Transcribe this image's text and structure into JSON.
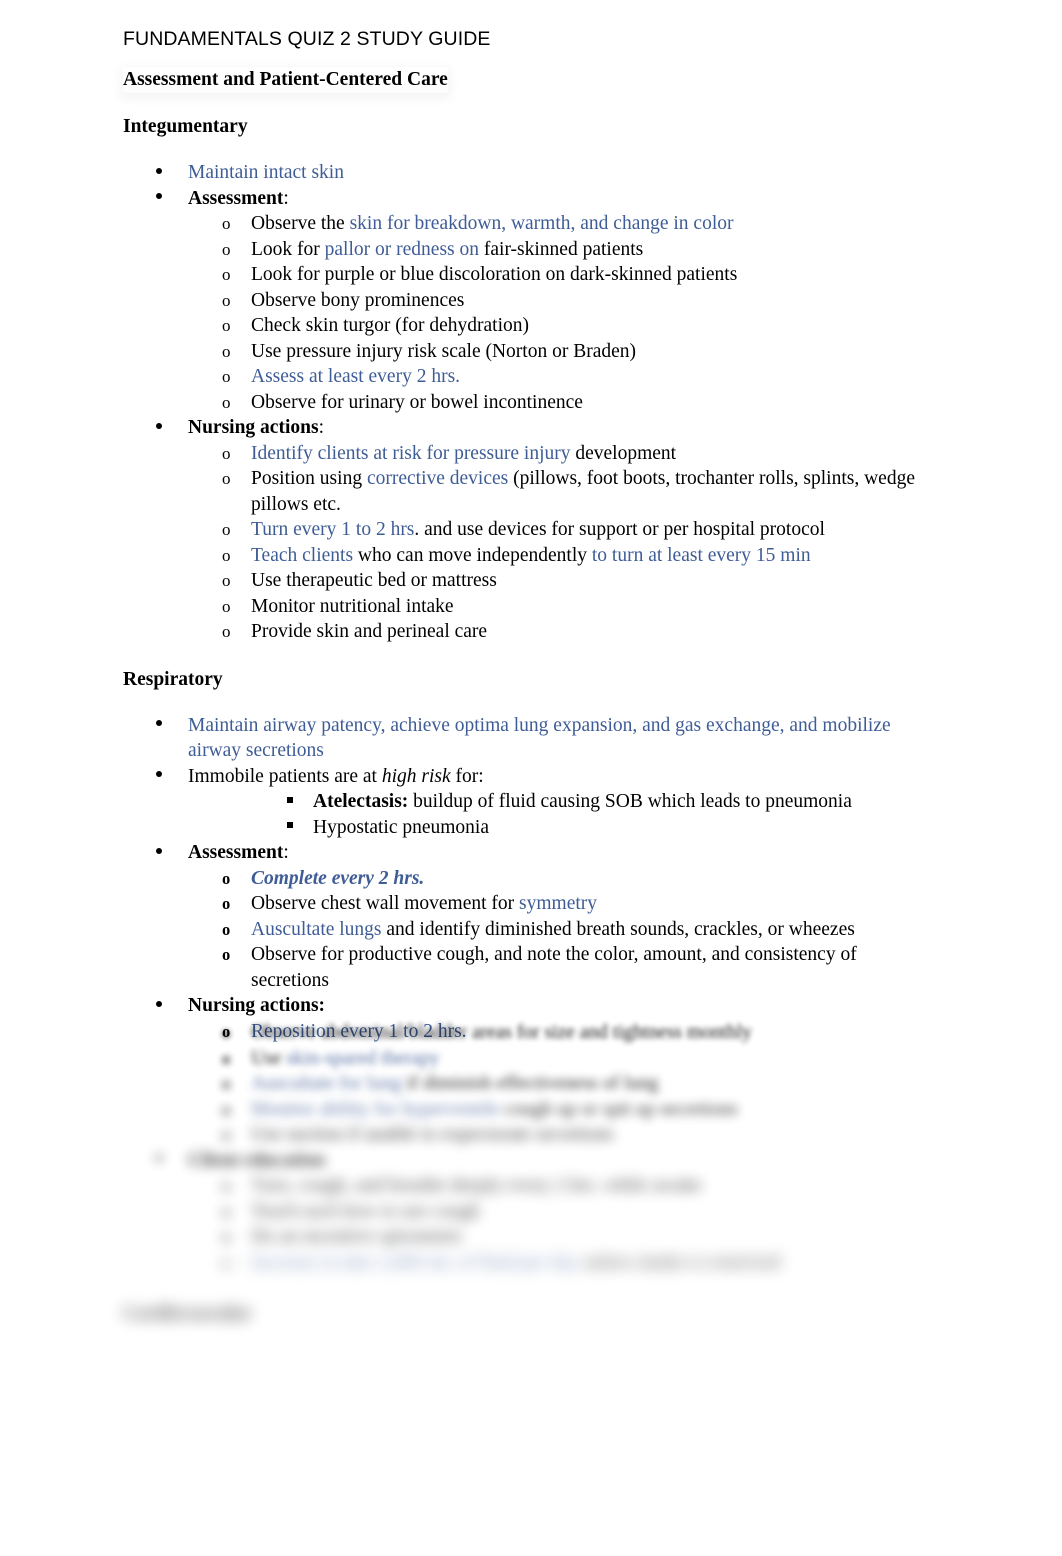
{
  "document": {
    "title": "FUNDAMENTALS QUIZ 2 STUDY GUIDE",
    "heading_main": "Assessment and Patient-Centered Care",
    "colors": {
      "accent_blue": "#3e5c96",
      "text_black": "#000000",
      "page_background": "#ffffff"
    }
  },
  "sections": [
    {
      "heading": "Integumentary",
      "items": [
        {
          "level": 1,
          "marker": "bullet",
          "runs": [
            {
              "t": "Maintain intact skin",
              "s": "blue"
            }
          ]
        },
        {
          "level": 1,
          "marker": "bullet",
          "runs": [
            {
              "t": "Assessment",
              "s": "bold"
            },
            {
              "t": ":",
              "s": "plain"
            }
          ]
        },
        {
          "level": 2,
          "marker": "o",
          "runs": [
            {
              "t": "Observe the ",
              "s": "plain"
            },
            {
              "t": "skin for breakdown, warmth, and change in color",
              "s": "blue"
            }
          ]
        },
        {
          "level": 2,
          "marker": "o",
          "runs": [
            {
              "t": "Look for ",
              "s": "plain"
            },
            {
              "t": "pallor or redness on ",
              "s": "blue"
            },
            {
              "t": "fair-skinned patients",
              "s": "plain"
            }
          ]
        },
        {
          "level": 2,
          "marker": "o",
          "runs": [
            {
              "t": "Look for purple or blue discoloration on dark-skinned patients",
              "s": "plain"
            }
          ]
        },
        {
          "level": 2,
          "marker": "o",
          "runs": [
            {
              "t": "Observe bony prominences",
              "s": "plain"
            }
          ]
        },
        {
          "level": 2,
          "marker": "o",
          "runs": [
            {
              "t": "Check skin turgor (for dehydration)",
              "s": "plain"
            }
          ]
        },
        {
          "level": 2,
          "marker": "o",
          "runs": [
            {
              "t": "Use pressure injury risk scale (Norton or Braden)",
              "s": "plain"
            }
          ]
        },
        {
          "level": 2,
          "marker": "o",
          "runs": [
            {
              "t": "Assess at least every 2 hrs.",
              "s": "blue"
            }
          ]
        },
        {
          "level": 2,
          "marker": "o",
          "runs": [
            {
              "t": "Observe for urinary or bowel incontinence",
              "s": "plain"
            }
          ]
        },
        {
          "level": 1,
          "marker": "bullet",
          "runs": [
            {
              "t": "Nursing actions",
              "s": "bold"
            },
            {
              "t": ":",
              "s": "plain"
            }
          ]
        },
        {
          "level": 2,
          "marker": "o",
          "runs": [
            {
              "t": "Identify clients at risk for pressure injury",
              "s": "blue"
            },
            {
              "t": " development",
              "s": "plain"
            }
          ]
        },
        {
          "level": 2,
          "marker": "o",
          "runs": [
            {
              "t": "Position using ",
              "s": "plain"
            },
            {
              "t": "corrective devices",
              "s": "blue"
            },
            {
              "t": " (pillows, foot boots, trochanter rolls, splints, wedge pillows etc.",
              "s": "plain"
            }
          ]
        },
        {
          "level": 2,
          "marker": "o",
          "runs": [
            {
              "t": "Turn every 1 to 2 hrs",
              "s": "blue"
            },
            {
              "t": ". and use devices for support or per hospital protocol",
              "s": "plain"
            }
          ]
        },
        {
          "level": 2,
          "marker": "o",
          "runs": [
            {
              "t": "Teach clients",
              "s": "blue"
            },
            {
              "t": " who can move independently ",
              "s": "plain"
            },
            {
              "t": "to turn at least every 15 min",
              "s": "blue"
            }
          ]
        },
        {
          "level": 2,
          "marker": "o",
          "runs": [
            {
              "t": "Use therapeutic bed or mattress",
              "s": "plain"
            }
          ]
        },
        {
          "level": 2,
          "marker": "o",
          "runs": [
            {
              "t": "Monitor nutritional intake",
              "s": "plain"
            }
          ]
        },
        {
          "level": 2,
          "marker": "o",
          "runs": [
            {
              "t": "Provide skin and perineal care",
              "s": "plain"
            }
          ]
        }
      ]
    },
    {
      "heading": "Respiratory",
      "items": [
        {
          "level": 1,
          "marker": "bullet",
          "runs": [
            {
              "t": "Maintain airway patency, achieve optima lung expansion, and gas exchange, and mobilize airway secretions",
              "s": "blue"
            }
          ]
        },
        {
          "level": 1,
          "marker": "bullet",
          "runs": [
            {
              "t": "Immobile patients are at ",
              "s": "plain"
            },
            {
              "t": "high risk",
              "s": "italic"
            },
            {
              "t": " for:",
              "s": "plain"
            }
          ]
        },
        {
          "level": 3,
          "marker": "square",
          "runs": [
            {
              "t": "Atelectasis:",
              "s": "bold"
            },
            {
              "t": " buildup of fluid causing SOB which leads to pneumonia",
              "s": "plain"
            }
          ]
        },
        {
          "level": 3,
          "marker": "square",
          "runs": [
            {
              "t": "Hypostatic pneumonia",
              "s": "plain"
            }
          ]
        },
        {
          "level": 1,
          "marker": "bullet",
          "runs": [
            {
              "t": "Assessment",
              "s": "bold"
            },
            {
              "t": ":",
              "s": "plain"
            }
          ]
        },
        {
          "level": 2,
          "marker": "o-bold",
          "runs": [
            {
              "t": "Complete every 2 hrs.",
              "s": "blue-bold-italic"
            }
          ]
        },
        {
          "level": 2,
          "marker": "o-bold",
          "runs": [
            {
              "t": "Observe chest wall movement for ",
              "s": "plain"
            },
            {
              "t": "symmetry",
              "s": "blue"
            }
          ]
        },
        {
          "level": 2,
          "marker": "o-bold",
          "runs": [
            {
              "t": "Auscultate lungs",
              "s": "blue"
            },
            {
              "t": " and identify diminished breath sounds, crackles, or wheezes",
              "s": "plain"
            }
          ]
        },
        {
          "level": 2,
          "marker": "o-bold",
          "runs": [
            {
              "t": "Observe for productive cough, and note the color, amount, and consistency of secretions",
              "s": "plain"
            }
          ]
        },
        {
          "level": 1,
          "marker": "bullet",
          "runs": [
            {
              "t": "Nursing actions:",
              "s": "bold"
            }
          ]
        },
        {
          "level": 2,
          "marker": "o-bold",
          "runs": [
            {
              "t": "Reposition every 1 to 2 hrs.",
              "s": "blue"
            }
          ]
        }
      ]
    }
  ],
  "obscured": {
    "note": "Lower portion of the page is blurred out (preview fade); text is not legible.",
    "lines": [
      {
        "level": 2,
        "blur": 1,
        "runs": [
          {
            "t": "Observe abdominal/bladder areas for size and tightness monthly",
            "s": "plain"
          }
        ]
      },
      {
        "level": 2,
        "blur": 2,
        "runs": [
          {
            "t": "Use ",
            "s": "plain"
          },
          {
            "t": "skin-spared therapy",
            "s": "blue"
          }
        ]
      },
      {
        "level": 2,
        "blur": 3,
        "runs": [
          {
            "t": "Auscultate for lung",
            "s": "blue"
          },
          {
            "t": " if diminish effectiveness of lung",
            "s": "plain"
          }
        ]
      },
      {
        "level": 2,
        "blur": 4,
        "runs": [
          {
            "t": "Monitor ability for hyperventile",
            "s": "blue"
          },
          {
            "t": " cough up or spit up secretions",
            "s": "plain"
          }
        ]
      },
      {
        "level": 2,
        "blur": 5,
        "runs": [
          {
            "t": "Use suction if unable to expectorate secretions",
            "s": "plain"
          }
        ]
      },
      {
        "level": 1,
        "blur": 5,
        "runs": [
          {
            "t": "Client education",
            "s": "bold"
          }
        ]
      },
      {
        "level": 2,
        "blur": 6,
        "runs": [
          {
            "t": "Turn, cough, and breathe deeply every 2 hrs. while awake",
            "s": "plain"
          }
        ]
      },
      {
        "level": 2,
        "blur": 6,
        "runs": [
          {
            "t": "Teach each how to use cough",
            "s": "plain"
          }
        ]
      },
      {
        "level": 2,
        "blur": 6,
        "runs": [
          {
            "t": "Do an incentive spirometer",
            "s": "plain"
          }
        ]
      },
      {
        "level": 2,
        "blur": 7,
        "runs": [
          {
            "t": "Increase in take 2,000 mL of fluid per day",
            "s": "blue"
          },
          {
            "t": " unless intake is restricted",
            "s": "plain"
          }
        ]
      }
    ],
    "trailing_heading": {
      "blur": 7,
      "text": "Cardiovascular"
    }
  }
}
